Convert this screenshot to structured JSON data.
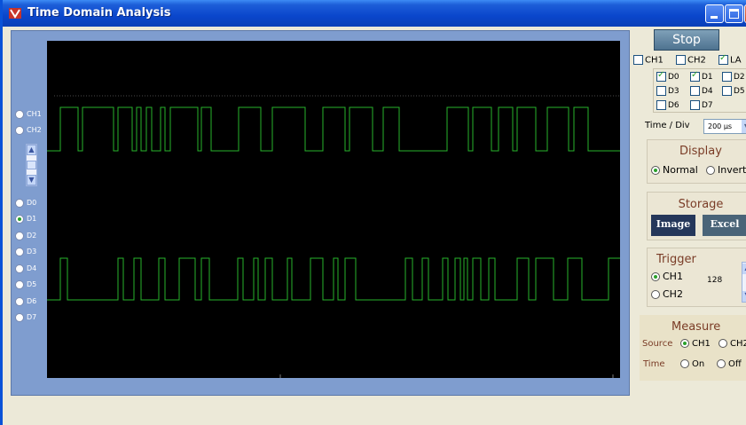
{
  "window": {
    "title": "Time Domain Analysis"
  },
  "channels": {
    "analog": [
      "CH1",
      "CH2"
    ],
    "digital": [
      "D0",
      "D1",
      "D2",
      "D3",
      "D4",
      "D5",
      "D6",
      "D7"
    ],
    "selected": "D1"
  },
  "controls": {
    "stop_label": "Stop",
    "top_checks": [
      {
        "label": "CH1",
        "checked": false
      },
      {
        "label": "CH2",
        "checked": false
      },
      {
        "label": "LA",
        "checked": true
      }
    ],
    "digital_checks": [
      {
        "label": "D0",
        "checked": true
      },
      {
        "label": "D1",
        "checked": true
      },
      {
        "label": "D2",
        "checked": false
      },
      {
        "label": "D3",
        "checked": false
      },
      {
        "label": "D4",
        "checked": false
      },
      {
        "label": "D5",
        "checked": false
      },
      {
        "label": "D6",
        "checked": false
      },
      {
        "label": "D7",
        "checked": false
      }
    ],
    "time_div_label": "Time / Div",
    "time_div_value": "200 µs"
  },
  "display": {
    "title": "Display",
    "normal": "Normal",
    "invert": "Invert",
    "selected": "Normal"
  },
  "storage": {
    "title": "Storage",
    "image": "Image",
    "excel": "Excel"
  },
  "trigger": {
    "title": "Trigger",
    "ch1": "CH1",
    "ch2": "CH2",
    "selected": "CH1",
    "level": "128"
  },
  "measure": {
    "title": "Measure",
    "source_label": "Source",
    "source_ch1": "CH1",
    "source_ch2": "CH2",
    "time_label": "Time",
    "on": "On",
    "off": "Off"
  },
  "colors": {
    "trace": "#27b52c",
    "scope_bg": "#000000",
    "panel": "#7f9dcf"
  }
}
